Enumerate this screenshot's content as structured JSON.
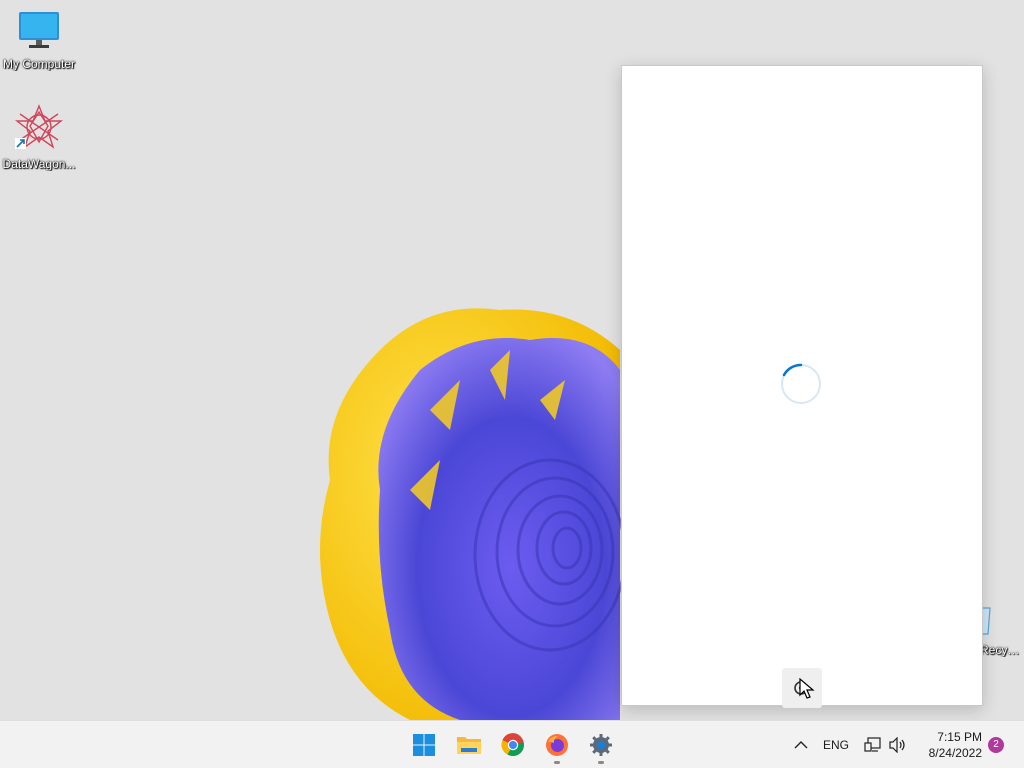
{
  "desktop": {
    "icons": [
      {
        "label": "My Computer"
      },
      {
        "label": "DataWagon..."
      },
      {
        "label": "Recycle Bin"
      }
    ]
  },
  "popup": {
    "state": "loading"
  },
  "taskbar": {
    "apps": [
      {
        "name": "start",
        "icon": "windows-start-icon"
      },
      {
        "name": "file-explorer",
        "icon": "folder-icon"
      },
      {
        "name": "chrome",
        "icon": "chrome-icon"
      },
      {
        "name": "firefox",
        "icon": "firefox-icon"
      },
      {
        "name": "settings",
        "icon": "gear-icon"
      }
    ],
    "tray": {
      "language": "ENG",
      "time": "7:15 PM",
      "date": "8/24/2022",
      "notification_count": "2"
    }
  },
  "colors": {
    "accent": "#0078d4",
    "desktop_bg": "#e2e2e2",
    "wallpaper_yellow": "#f7cf1e",
    "wallpaper_purple": "#5b4ed8",
    "notification_badge": "#b1399a"
  }
}
